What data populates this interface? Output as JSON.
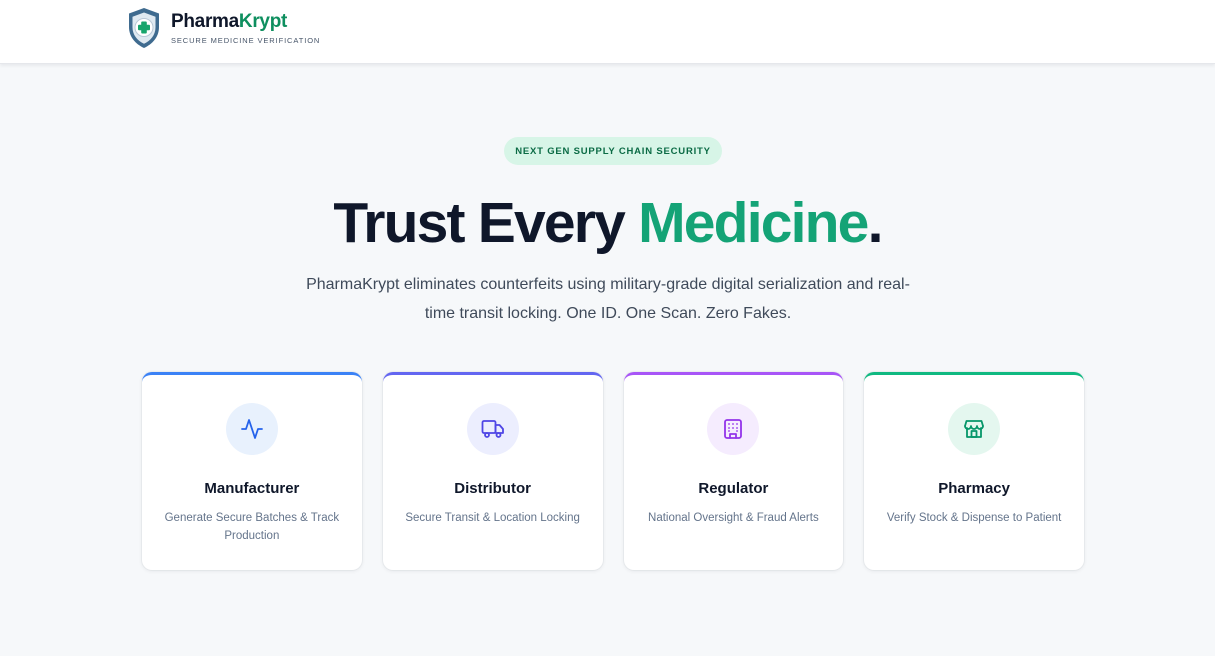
{
  "header": {
    "brand_part1": "Pharma",
    "brand_part2": "Krypt",
    "tagline": "SECURE MEDICINE VERIFICATION",
    "brand_color": "#0e8f5f"
  },
  "hero": {
    "badge": "NEXT GEN SUPPLY CHAIN SECURITY",
    "title_part1": "Trust Every ",
    "title_accent": "Medicine",
    "title_end": ".",
    "accent_color": "#14a376",
    "description": "PharmaKrypt eliminates counterfeits using military-grade digital serialization and real-time transit locking. One ID. One Scan. Zero Fakes."
  },
  "cards": [
    {
      "title": "Manufacturer",
      "description": "Generate Secure Batches & Track Production",
      "icon": "activity-icon",
      "accent": "#3b82f6",
      "icon_bg": "#e8f1fd",
      "icon_color": "#2563eb"
    },
    {
      "title": "Distributor",
      "description": "Secure Transit & Location Locking",
      "icon": "truck-icon",
      "accent": "#6366f1",
      "icon_bg": "#eceefe",
      "icon_color": "#4f46e5"
    },
    {
      "title": "Regulator",
      "description": "National Oversight & Fraud Alerts",
      "icon": "building-icon",
      "accent": "#a855f7",
      "icon_bg": "#f5ecfe",
      "icon_color": "#9333ea"
    },
    {
      "title": "Pharmacy",
      "description": "Verify Stock & Dispense to Patient",
      "icon": "store-icon",
      "accent": "#10b981",
      "icon_bg": "#e4f7ef",
      "icon_color": "#059669"
    }
  ]
}
